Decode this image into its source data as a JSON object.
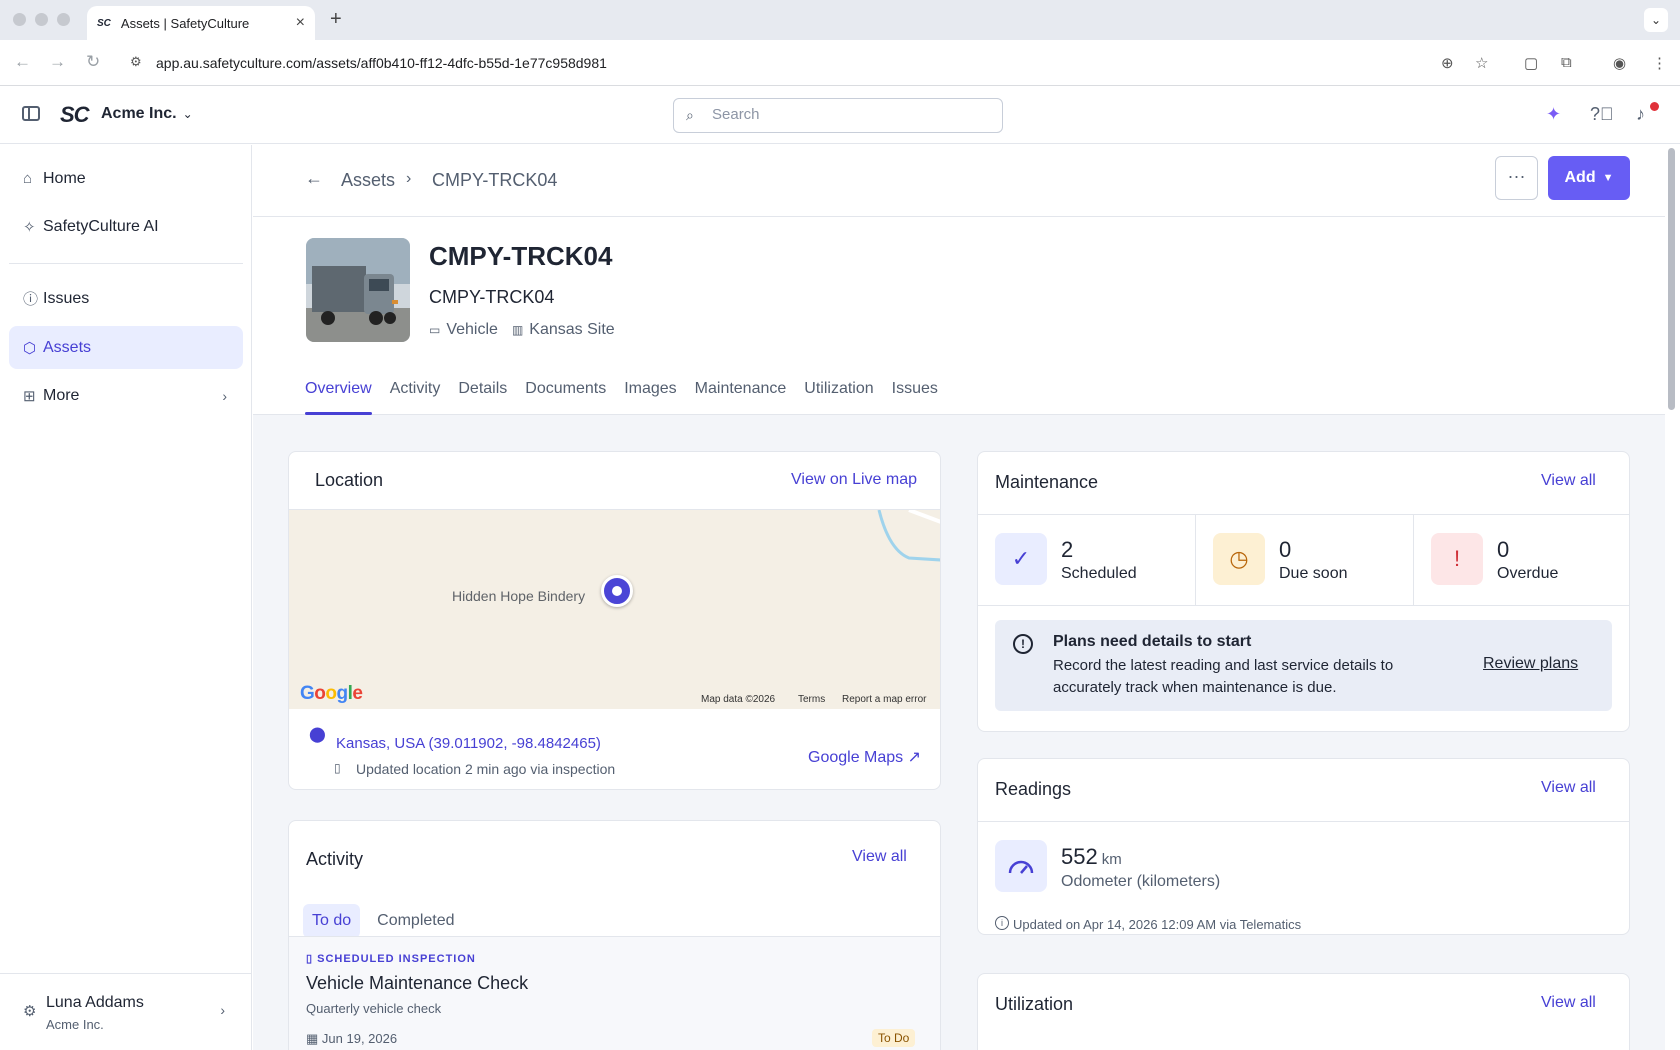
{
  "browser": {
    "tab_title": "Assets | SafetyCulture",
    "favicon_text": "SC",
    "url": "app.au.safetyculture.com/assets/aff0b410-ff12-4dfc-b55d-1e77c958d981"
  },
  "header": {
    "logo_text": "SC",
    "org_name": "Acme Inc.",
    "search_placeholder": "Search"
  },
  "sidebar": {
    "items": [
      {
        "label": "Home",
        "icon": "home-icon"
      },
      {
        "label": "SafetyCulture AI",
        "icon": "sparkle-icon"
      },
      {
        "label": "Issues",
        "icon": "issue-icon"
      },
      {
        "label": "Assets",
        "icon": "cube-icon",
        "active": true
      },
      {
        "label": "More",
        "icon": "grid-icon"
      }
    ],
    "user": {
      "name": "Luna Addams",
      "org": "Acme Inc."
    }
  },
  "breadcrumb": {
    "parent": "Assets",
    "current": "CMPY-TRCK04"
  },
  "actions": {
    "more": "···",
    "add": "Add"
  },
  "asset": {
    "title": "CMPY-TRCK04",
    "subtitle": "CMPY-TRCK04",
    "type": "Vehicle",
    "site": "Kansas Site"
  },
  "tabs": [
    "Overview",
    "Activity",
    "Details",
    "Documents",
    "Images",
    "Maintenance",
    "Utilization",
    "Issues"
  ],
  "location": {
    "title": "Location",
    "view_link": "View on Live map",
    "map_label": "Hidden Hope Bindery",
    "google": "Google",
    "map_data": "Map data ©2026",
    "terms": "Terms",
    "report": "Report a map error",
    "address": "Kansas, USA (39.011902, -98.4842465)",
    "updated": "Updated location 2 min ago via inspection",
    "gmaps_link": "Google Maps"
  },
  "activity": {
    "title": "Activity",
    "view_all": "View all",
    "tabs": [
      "To do",
      "Completed"
    ],
    "item": {
      "kind": "SCHEDULED INSPECTION",
      "name": "Vehicle Maintenance Check",
      "desc": "Quarterly vehicle check",
      "date": "Jun 19, 2026",
      "status": "To Do"
    }
  },
  "maintenance": {
    "title": "Maintenance",
    "view_all": "View all",
    "stats": [
      {
        "num": "2",
        "label": "Scheduled",
        "color": "#4740d4",
        "bg": "#e9edff"
      },
      {
        "num": "0",
        "label": "Due soon",
        "color": "#b8660a",
        "bg": "#fdf0d3"
      },
      {
        "num": "0",
        "label": "Overdue",
        "color": "#d0323a",
        "bg": "#fde6e7"
      }
    ],
    "notice": {
      "title": "Plans need details to start",
      "body": "Record the latest reading and last service details to accurately track when maintenance is due.",
      "link": "Review plans"
    }
  },
  "readings": {
    "title": "Readings",
    "view_all": "View all",
    "value": "552",
    "unit": "km",
    "label": "Odometer (kilometers)",
    "updated": "Updated on Apr 14, 2026 12:09 AM via Telematics"
  },
  "utilization": {
    "title": "Utilization",
    "view_all": "View all"
  },
  "colors": {
    "accent": "#4740d4",
    "button": "#675df4"
  }
}
